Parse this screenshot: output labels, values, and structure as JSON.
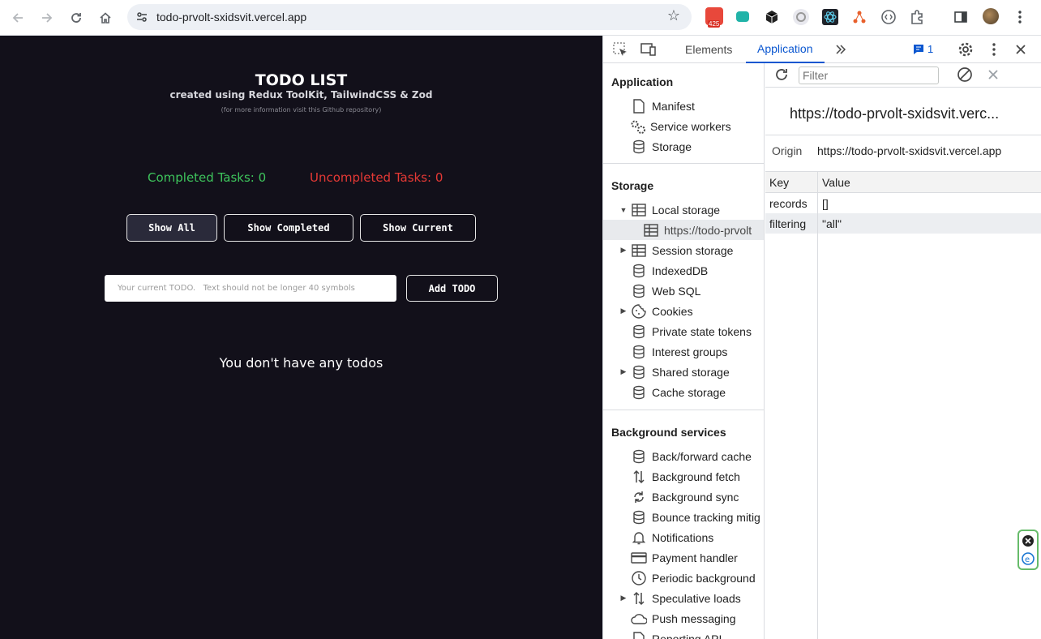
{
  "browser": {
    "url": "todo-prvolt-sxidsvit.vercel.app",
    "ext_badge_count": "425"
  },
  "app": {
    "title": "TODO LIST",
    "subtitle": "created using Redux ToolKit, TailwindCSS & Zod",
    "note": "(for more information visit this Github repository)",
    "completed_label": "Completed Tasks: 0",
    "uncompleted_label": "Uncompleted Tasks: 0",
    "filters": [
      "Show All",
      "Show Completed",
      "Show Current"
    ],
    "active_filter": "Show All",
    "input_placeholder": "Your current TODO.   Text should not be longer 40 symbols",
    "add_label": "Add TODO",
    "empty_message": "You don't have any todos",
    "colors": {
      "bg": "#12101a",
      "completed": "#3ec55c",
      "uncompleted": "#e53935"
    }
  },
  "devtools": {
    "tabs": [
      "Elements",
      "Application"
    ],
    "active_tab": "Application",
    "issues_count": "1",
    "sidebar": {
      "application_title": "Application",
      "application_items": [
        {
          "label": "Manifest",
          "icon": "document-icon"
        },
        {
          "label": "Service workers",
          "icon": "gears-icon"
        },
        {
          "label": "Storage",
          "icon": "database-icon"
        }
      ],
      "storage_title": "Storage",
      "storage_items": [
        {
          "label": "Local storage",
          "icon": "table-icon",
          "expanded": true
        },
        {
          "label": "https://todo-prvolt",
          "icon": "table-icon",
          "child": true
        },
        {
          "label": "Session storage",
          "icon": "table-icon",
          "expandable": true
        },
        {
          "label": "IndexedDB",
          "icon": "database-icon"
        },
        {
          "label": "Web SQL",
          "icon": "database-icon"
        },
        {
          "label": "Cookies",
          "icon": "cookie-icon",
          "expandable": true
        },
        {
          "label": "Private state tokens",
          "icon": "database-icon"
        },
        {
          "label": "Interest groups",
          "icon": "database-icon"
        },
        {
          "label": "Shared storage",
          "icon": "database-icon",
          "expandable": true
        },
        {
          "label": "Cache storage",
          "icon": "database-icon"
        }
      ],
      "background_title": "Background services",
      "background_items": [
        {
          "label": "Back/forward cache",
          "icon": "database-icon"
        },
        {
          "label": "Background fetch",
          "icon": "updown-icon"
        },
        {
          "label": "Background sync",
          "icon": "sync-icon"
        },
        {
          "label": "Bounce tracking mitig",
          "icon": "database-icon"
        },
        {
          "label": "Notifications",
          "icon": "bell-icon"
        },
        {
          "label": "Payment handler",
          "icon": "card-icon"
        },
        {
          "label": "Periodic background",
          "icon": "clock-icon"
        },
        {
          "label": "Speculative loads",
          "icon": "updown-icon",
          "expandable": true
        },
        {
          "label": "Push messaging",
          "icon": "cloud-icon"
        },
        {
          "label": "Reporting API",
          "icon": "document-icon"
        }
      ]
    },
    "main": {
      "filter_placeholder": "Filter",
      "origin_heading": "https://todo-prvolt-sxidsvit.verc...",
      "origin_label": "Origin",
      "origin_value": "https://todo-prvolt-sxidsvit.vercel.app",
      "table_headers": [
        "Key",
        "Value"
      ],
      "rows": [
        {
          "key": "records",
          "value": "[]"
        },
        {
          "key": "filtering",
          "value": "\"all\""
        }
      ]
    }
  }
}
